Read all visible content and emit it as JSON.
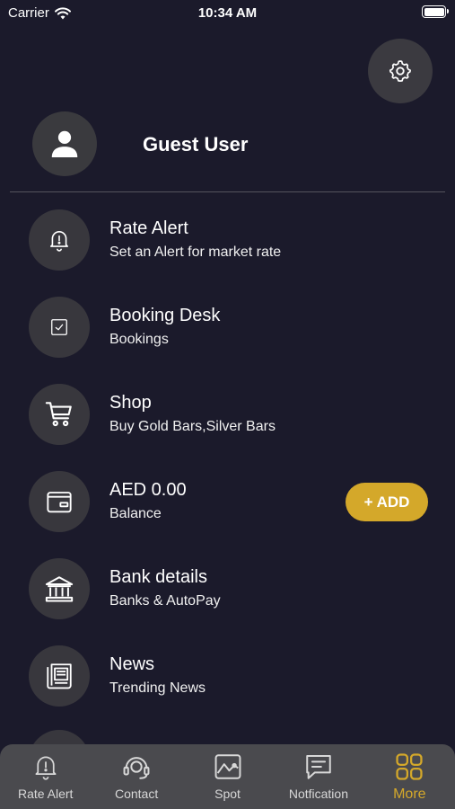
{
  "status_bar": {
    "carrier": "Carrier",
    "time": "10:34 AM"
  },
  "profile": {
    "name": "Guest User",
    "avatar_icon": "person-icon"
  },
  "settings": {
    "icon": "gear-icon"
  },
  "menu": [
    {
      "title": "Rate Alert",
      "subtitle": "Set an Alert for market rate",
      "icon": "bell-icon"
    },
    {
      "title": "Booking Desk",
      "subtitle": "Bookings",
      "icon": "checkbox-icon"
    },
    {
      "title": "Shop",
      "subtitle": "Buy Gold Bars,Silver Bars",
      "icon": "cart-icon"
    },
    {
      "title": "AED 0.00",
      "subtitle": "Balance",
      "icon": "wallet-icon"
    },
    {
      "title": "Bank details",
      "subtitle": "Banks & AutoPay",
      "icon": "bank-icon"
    },
    {
      "title": "News",
      "subtitle": "Trending News",
      "icon": "newspaper-icon"
    }
  ],
  "balance": {
    "add_label": "+ ADD"
  },
  "tab_bar": {
    "tabs": [
      {
        "label": "Rate Alert",
        "icon": "bell-icon"
      },
      {
        "label": "Contact",
        "icon": "headset-icon"
      },
      {
        "label": "Spot",
        "icon": "chart-icon"
      },
      {
        "label": "Notfication",
        "icon": "message-icon"
      },
      {
        "label": "More",
        "icon": "grid-icon"
      }
    ],
    "active_tab": "More"
  },
  "colors": {
    "background": "#1b1a2b",
    "accent": "#d4a82a",
    "icon_circle": "#38373d",
    "tab_bar": "#4a4a4e"
  }
}
